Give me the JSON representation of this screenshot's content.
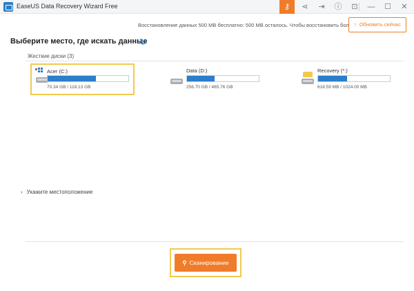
{
  "window": {
    "title": "EaseUS Data Recovery Wizard Free",
    "icons": [
      "key-icon",
      "share-icon",
      "login-icon",
      "help-icon",
      "exit-icon",
      "minimize-icon",
      "maximize-icon",
      "close-icon"
    ]
  },
  "banner": {
    "info": "Восстановление данных 500 MB бесплатно: 500 MB осталось. Чтобы восстановить больше,",
    "upgrade_label": "Обновить сейчас"
  },
  "main": {
    "title": "Выберите место, где искать данные",
    "hard_disks_label": "Жесткие диски (3)",
    "drives": [
      {
        "name": "Acer (C:)",
        "size": "70.34 GB / 118.13 GB",
        "used_fraction": 0.6
      },
      {
        "name": "Data (D:)",
        "size": "256.70 GB / 465.76 GB",
        "used_fraction": 0.38
      },
      {
        "name": "Recovery (*:)",
        "size": "618.59 MB / 1024.00 MB",
        "used_fraction": 0.4
      }
    ],
    "specify_location": "Укажите местоположение",
    "scan_label": "Сканирование"
  },
  "colors": {
    "accent": "#f07c2a",
    "highlight": "#f2c94c",
    "bar": "#2b7ec9"
  }
}
